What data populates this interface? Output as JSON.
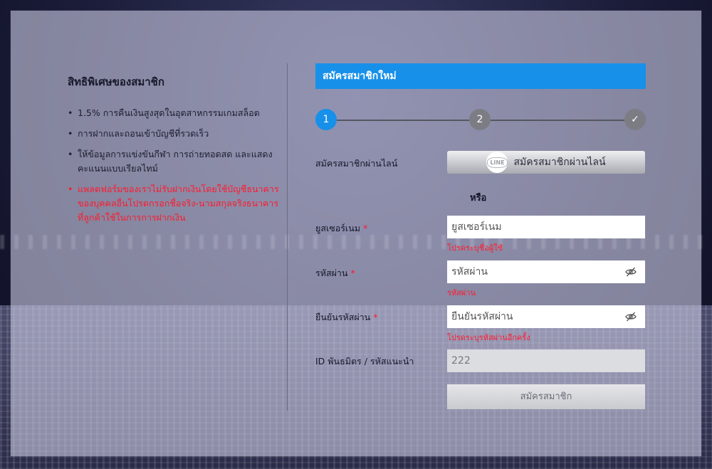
{
  "benefits": {
    "title": "สิทธิพิเศษของสมาชิก",
    "items": [
      "1.5% การคืนเงินสูงสุดในอุตสาหกรรมเกมสล็อต",
      "การฝากและถอนเข้าบัญชีที่รวดเร็ว",
      "ให้ข้อมูลการแข่งขันกีฬา การถ่ายทอดสด และแสดงคะแนนแบบเรียลไทม์"
    ],
    "warning": "แพลตฟอร์มของเราไม่รับฝากเงินโดยใช้บัญชีธนาคารของบุคคลอื่นโปรดกรอกชื่อจริง-นามสกุลจริงธนาคารที่ลูกค้าใช้ในการการฝากเงิน"
  },
  "register": {
    "header": "สมัครสมาชิกใหม่",
    "steps": [
      "1",
      "2",
      "✓"
    ],
    "line_label": "สมัครสมาชิกผ่านไลน์",
    "line_logo": "LINE",
    "line_button": "สมัครสมาชิกผ่านไลน์",
    "or": "หรือ",
    "username": {
      "label": "ยูสเซอร์เนม",
      "placeholder": "ยูสเซอร์เนม",
      "error": "โปรดระบุชื่อผู้ใช้"
    },
    "password": {
      "label": "รหัสผ่าน",
      "placeholder": "รหัสผ่าน",
      "error": "รหัสผ่าน"
    },
    "confirm": {
      "label": "ยืนยันรหัสผ่าน",
      "placeholder": "ยืนยันรหัสผ่าน",
      "error": "โปรดระบุรหัสผ่านอีกครั้ง"
    },
    "referral": {
      "label": "ID พันธมิตร / รหัสแนะนำ",
      "value": "222"
    },
    "required_mark": "*",
    "submit": "สมัครสมาชิก"
  },
  "colors": {
    "accent": "#1790ea",
    "error": "#ff1a2e",
    "step_inactive": "#7c7d84"
  },
  "icons": {
    "password_toggle": "eye-slash-icon",
    "step_done": "check-icon"
  }
}
